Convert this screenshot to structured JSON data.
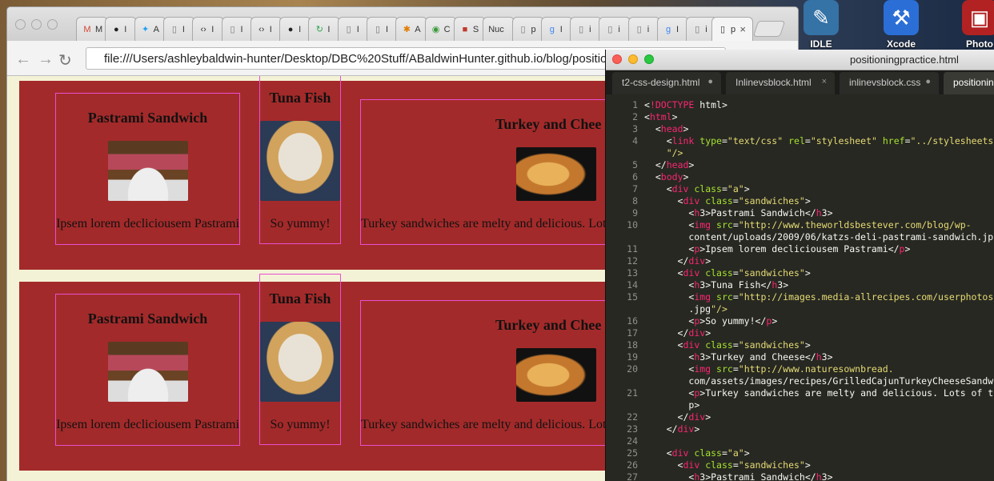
{
  "desktop": {
    "icons": [
      {
        "label": "IDLE",
        "icon": "python-feather-icon"
      },
      {
        "label": "Xcode",
        "icon": "xcode-hammer-icon"
      },
      {
        "label": "Photo",
        "icon": "photo-booth-icon"
      }
    ]
  },
  "browser": {
    "tabs": [
      {
        "label": "M",
        "icon": "gmail-icon",
        "color": "#d14836"
      },
      {
        "label": "I",
        "icon": "github-icon",
        "color": "#222222"
      },
      {
        "label": "A",
        "icon": "twitter-icon",
        "color": "#1da1f2"
      },
      {
        "label": "I",
        "icon": "page-icon",
        "color": "#777777"
      },
      {
        "label": "I",
        "icon": "code-icon",
        "color": "#333333"
      },
      {
        "label": "I",
        "icon": "page-icon",
        "color": "#777777"
      },
      {
        "label": "I",
        "icon": "code-icon",
        "color": "#333333"
      },
      {
        "label": "I",
        "icon": "github-icon",
        "color": "#222222"
      },
      {
        "label": "I",
        "icon": "refresh-green-icon",
        "color": "#2ea44f"
      },
      {
        "label": "I",
        "icon": "page-icon",
        "color": "#777777"
      },
      {
        "label": "I",
        "icon": "page-icon",
        "color": "#777777"
      },
      {
        "label": "A",
        "icon": "asterisk-icon",
        "color": "#e07b00"
      },
      {
        "label": "C",
        "icon": "green-circle-icon",
        "color": "#3a9a3a"
      },
      {
        "label": "S",
        "icon": "red-square-icon",
        "color": "#c0392b"
      },
      {
        "label": "Nuc",
        "icon": "none",
        "color": "#333333"
      },
      {
        "label": "p",
        "icon": "page-icon",
        "color": "#777777"
      },
      {
        "label": "I",
        "icon": "google-icon",
        "color": "#4285f4"
      },
      {
        "label": "i",
        "icon": "page-icon",
        "color": "#777777"
      },
      {
        "label": "i",
        "icon": "page-icon",
        "color": "#777777"
      },
      {
        "label": "i",
        "icon": "page-icon",
        "color": "#777777"
      },
      {
        "label": "I",
        "icon": "google-icon",
        "color": "#4285f4"
      },
      {
        "label": "i",
        "icon": "page-icon",
        "color": "#777777"
      }
    ],
    "active_tab": {
      "label": "p",
      "close": "×"
    },
    "url": "file:///Users/ashleybaldwin-hunter/Desktop/DBC%20Stuff/ABaldwinHunter.github.io/blog/positioningprac..."
  },
  "page": {
    "rows": [
      {
        "sandwiches": [
          {
            "title": "Pastrami Sandwich",
            "caption": "Ipsem lorem decliciousem Pastrami"
          },
          {
            "title": "Tuna Fish",
            "caption": "So yummy!"
          },
          {
            "title": "Turkey and Chee",
            "caption": "Turkey sandwiches are melty and delicious. Lot"
          }
        ]
      },
      {
        "sandwiches": [
          {
            "title": "Pastrami Sandwich",
            "caption": "Ipsem lorem decliciousem Pastrami"
          },
          {
            "title": "Tuna Fish",
            "caption": "So yummy!"
          },
          {
            "title": "Turkey and Chee",
            "caption": "Turkey sandwiches are melty and delicious. Lot"
          }
        ]
      }
    ],
    "colors": {
      "row_bg": "#a32a2a",
      "border": "#ea4fd1",
      "page_bg": "#f4f2d6"
    }
  },
  "editor": {
    "window_title": "positioningpractice.html",
    "tabs": [
      {
        "label": "t2-css-design.html",
        "mark": "●"
      },
      {
        "label": "Inlinevsblock.html",
        "mark": "×"
      },
      {
        "label": "inlinevsblock.css",
        "mark": "●"
      },
      {
        "label": "positioningpractice.html",
        "mark": ""
      }
    ],
    "line_numbers": [
      "1",
      "2",
      "3",
      "4",
      "",
      "5",
      "6",
      "7",
      "8",
      "9",
      "10",
      "",
      "11",
      "12",
      "13",
      "14",
      "15",
      "",
      "16",
      "17",
      "18",
      "19",
      "20",
      "",
      "21",
      "",
      "22",
      "23",
      "24",
      "25",
      "26",
      "27"
    ],
    "code_lines": [
      "<!DOCTYPE html>",
      "<html>",
      "  <head>",
      "    <link type=\"text/css\" rel=\"stylesheet\" href=\"../stylesheets",
      "    \"/>",
      "  </head>",
      "  <body>",
      "    <div class=\"a\">",
      "      <div class=\"sandwiches\">",
      "        <h3>Pastrami Sandwich</h3>",
      "        <img src=\"http://www.theworldsbestever.com/blog/wp-",
      "        content/uploads/2009/06/katzs-deli-pastrami-sandwich.jp",
      "        <p>Ipsem lorem decliciousem Pastrami</p>",
      "      </div>",
      "      <div class=\"sandwiches\">",
      "        <h3>Tuna Fish</h3>",
      "        <img src=\"http://images.media-allrecipes.com/userphotos",
      "        .jpg\"/>",
      "        <p>So yummy!</p>",
      "      </div>",
      "      <div class=\"sandwiches\">",
      "        <h3>Turkey and Cheese</h3>",
      "        <img src=\"http://www.naturesownbread.",
      "        com/assets/images/recipes/GrilledCajunTurkeyCheeseSandw",
      "        <p>Turkey sandwiches are melty and delicious. Lots of t",
      "        p>",
      "      </div>",
      "    </div>",
      "",
      "    <div class=\"a\">",
      "      <div class=\"sandwiches\">",
      "        <h3>Pastrami Sandwich</h3>"
    ]
  }
}
